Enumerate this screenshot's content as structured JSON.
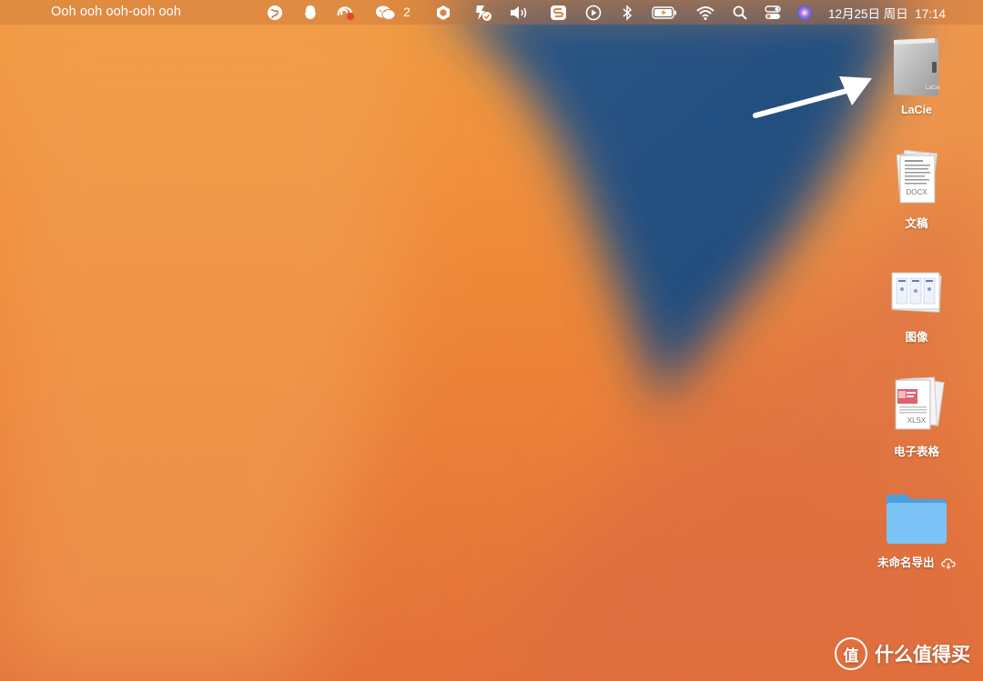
{
  "menubar": {
    "app_title": "Ooh ooh ooh-ooh ooh",
    "wechat_count": "2",
    "datetime": "12月25日 周日  17:14",
    "icons": [
      "globe-icon",
      "qq-icon",
      "sync-status-icon",
      "wechat-icon",
      "shield-app-icon",
      "vpn-icon",
      "volume-icon",
      "sogou-icon",
      "play-icon",
      "bluetooth-icon",
      "battery-icon",
      "wifi-icon",
      "search-icon",
      "control-center-icon",
      "siri-icon"
    ]
  },
  "desktop_icons": [
    {
      "name": "lacie-drive",
      "label": "LaCie"
    },
    {
      "name": "documents-stack",
      "label": "文稿",
      "badge": "DOCX"
    },
    {
      "name": "images-stack",
      "label": "图像"
    },
    {
      "name": "spreadsheets-stack",
      "label": "电子表格",
      "badge": "XLSX"
    },
    {
      "name": "export-folder",
      "label": "未命名导出"
    }
  ],
  "watermark": {
    "text": "什么值得买",
    "logo_glyph": "值"
  },
  "colors": {
    "wallpaper_orange": "#ee8638",
    "wallpaper_blue": "#1f4a78",
    "folder_blue": "#6cb8f0"
  }
}
